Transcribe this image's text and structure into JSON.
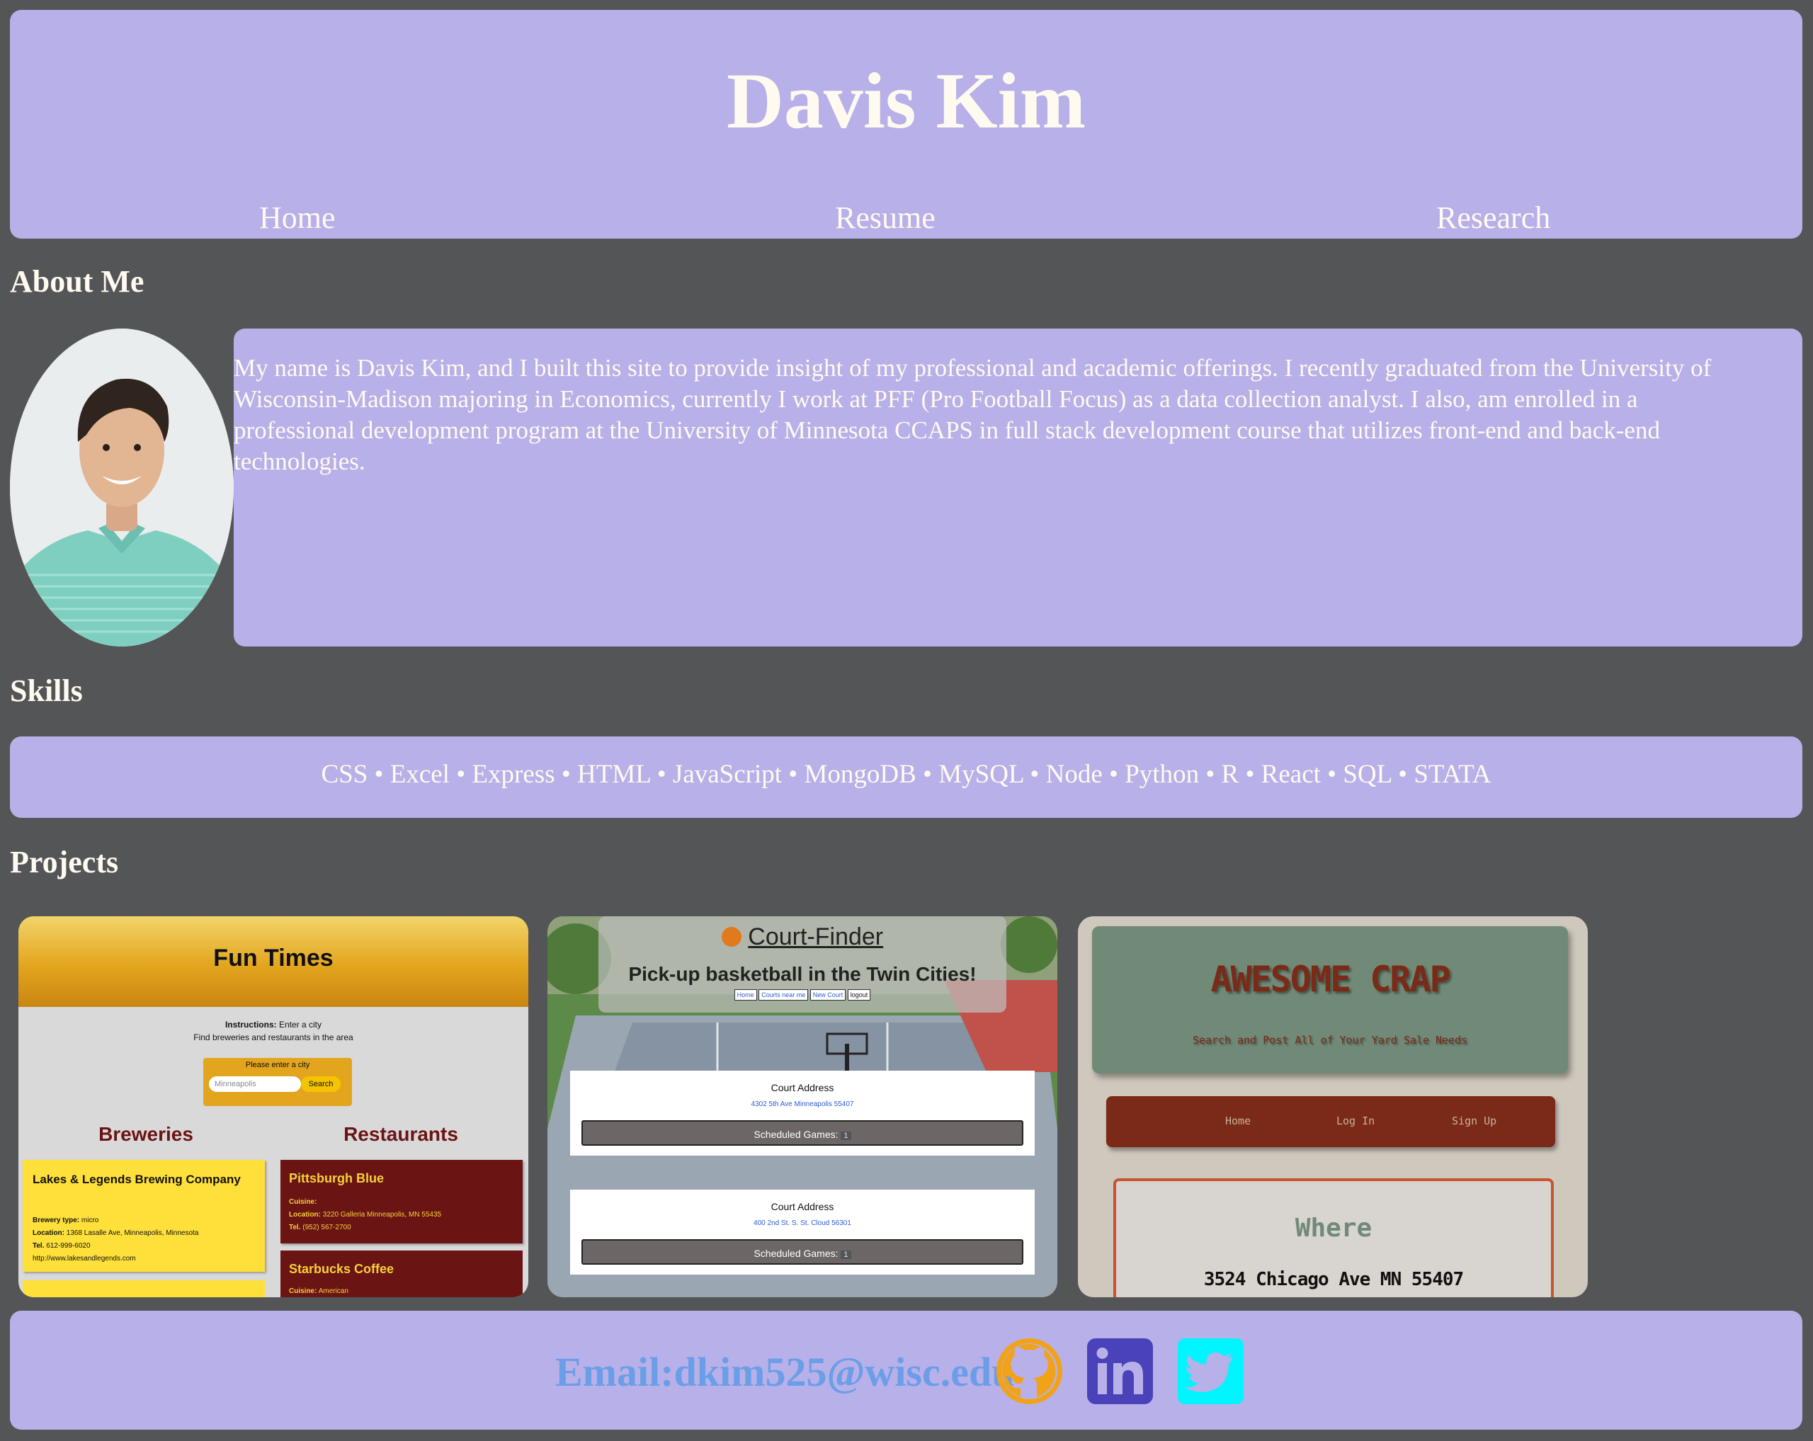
{
  "header": {
    "title": "Davis Kim",
    "nav": {
      "home": "Home",
      "resume": "Resume",
      "research": "Research"
    }
  },
  "about": {
    "heading": "About Me",
    "text": "My name is Davis Kim, and I built this site to provide insight of my professional and academic offerings. I recently graduated from the University of Wisconsin-Madison majoring in Economics, currently I work at PFF (Pro Football Focus) as a data collection analyst. I also, am enrolled in a professional development program at the University of Minnesota CCAPS in full stack development course that utilizes front-end and back-end technologies."
  },
  "skills": {
    "heading": "Skills",
    "list": "CSS • Excel • Express • HTML • JavaScript • MongoDB • MySQL • Node • Python • R • React • SQL • STATA"
  },
  "projects": {
    "heading": "Projects",
    "fun_times": {
      "title": "Fun Times",
      "instructions_label": "Instructions:",
      "instructions": "Enter a city",
      "subtext": "Find breweries and restaurants in the area",
      "prompt": "Please enter a city",
      "input_placeholder": "Minneapolis",
      "search_label": "Search",
      "breweries_heading": "Breweries",
      "restaurants_heading": "Restaurants",
      "brewery_name": "Lakes & Legends Brewing Company",
      "brewery_type_label": "Brewery type:",
      "brewery_type": "micro",
      "brewery_location_label": "Location:",
      "brewery_location": "1368 Lasalle Ave, Minneapolis, Minnesota",
      "brewery_tel_label": "Tel.",
      "brewery_tel": "612-999-6020",
      "brewery_url": "http://www.lakesandlegends.com",
      "restaurant_1_name": "Pittsburgh Blue",
      "restaurant_1_cuisine_label": "Cuisine:",
      "restaurant_1_location_label": "Location:",
      "restaurant_1_location": "3220 Galleria Minneapolis, MN 55435",
      "restaurant_1_tel_label": "Tel.",
      "restaurant_1_tel": "(952) 567-2700",
      "restaurant_2_name": "Starbucks Coffee",
      "restaurant_2_cuisine_label": "Cuisine:",
      "restaurant_2_cuisine": "American"
    },
    "court_finder": {
      "title": "Court-Finder",
      "subtitle": "Pick-up basketball in the Twin Cities!",
      "nav": [
        "Home",
        "Courts near me",
        "New Court",
        "logout"
      ],
      "courts": [
        {
          "label": "Court Address",
          "address": "4302 5th Ave Minneapolis 55407",
          "games_label": "Scheduled Games:",
          "games": "1"
        },
        {
          "label": "Court Address",
          "address": "400 2nd St. S. St. Cloud 56301",
          "games_label": "Scheduled Games:",
          "games": "1"
        }
      ]
    },
    "awesome_crap": {
      "title": "AWESOME CRAP",
      "subtitle": "Search and Post All of Your Yard Sale Needs",
      "nav": [
        "Home",
        "Log In",
        "Sign Up"
      ],
      "where_heading": "Where",
      "where_address": "3524 Chicago Ave MN 55407"
    }
  },
  "footer": {
    "email": "Email:dkim525@wisc.edu",
    "icons": [
      "github-icon",
      "linkedin-icon",
      "twitter-icon"
    ],
    "colors": {
      "github": "#f2a218",
      "linkedin": "#4a42b8",
      "twitter": "#00f5ff",
      "email": "#6b9ee8"
    }
  },
  "colors": {
    "panel": "#b8b0e8",
    "background": "#545557",
    "text": "#fffaf0"
  }
}
